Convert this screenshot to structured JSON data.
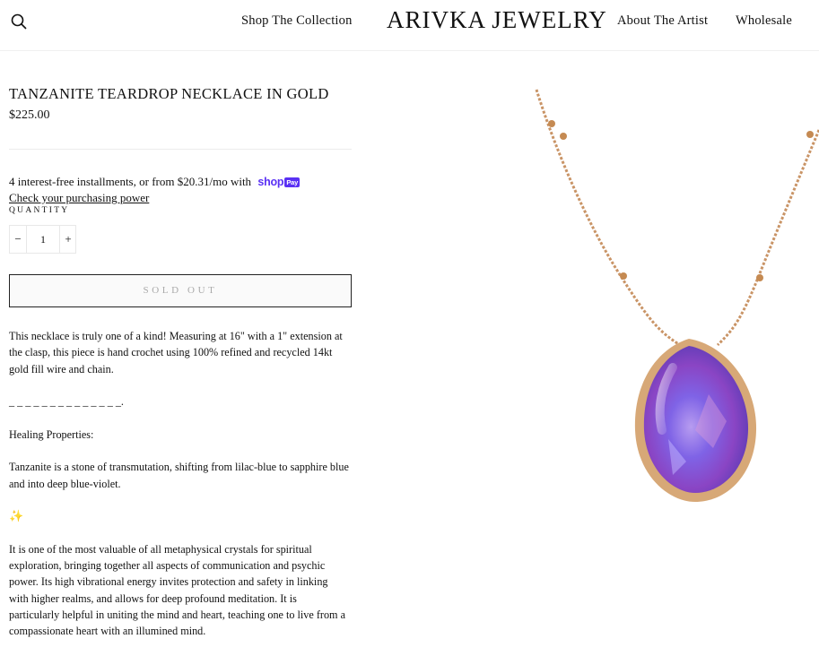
{
  "header": {
    "nav_left": "Shop The Collection",
    "brand": "ARIVKA JEWELRY",
    "nav_about": "About The Artist",
    "nav_wholesale": "Wholesale",
    "search_icon": "search-icon"
  },
  "product": {
    "title": "TANZANITE TEARDROP NECKLACE IN GOLD",
    "price": "$225.00",
    "installments_text": "4 interest-free installments, or from $20.31/mo with",
    "shop_logo": "shop",
    "pay_badge": "Pay",
    "purchasing_power": "Check your purchasing power",
    "quantity_label": "QUANTITY",
    "quantity_minus": "−",
    "quantity_value": "1",
    "quantity_plus": "+",
    "sold_out": "SOLD OUT",
    "description": {
      "p1": "This necklace is truly one of a kind! Measuring at 16\" with a 1\" extension at the clasp, this piece is hand crochet using 100% refined and recycled 14kt gold fill wire and chain.",
      "divider": "_ _ _ _ _ _ _ _ _ _ _ _ _ _.",
      "heading": "Healing Properties:",
      "p2": "Tanzanite is a stone of transmutation, shifting from lilac-blue to sapphire blue and into deep blue-violet.",
      "sparkle": "✨",
      "p3": "It is one of the most valuable of all metaphysical crystals for spiritual exploration, bringing together all aspects of communication and psychic power. Its high vibrational energy invites protection and safety in linking with higher realms, and allows for deep profound meditation. It is particularly helpful in uniting the mind and heart, teaching one to live from a compassionate heart with an illumined mind."
    }
  },
  "colors": {
    "shop_pay": "#5a31f4",
    "gold_chain": "#c99466",
    "stone_violet": "#8a5ad8"
  }
}
